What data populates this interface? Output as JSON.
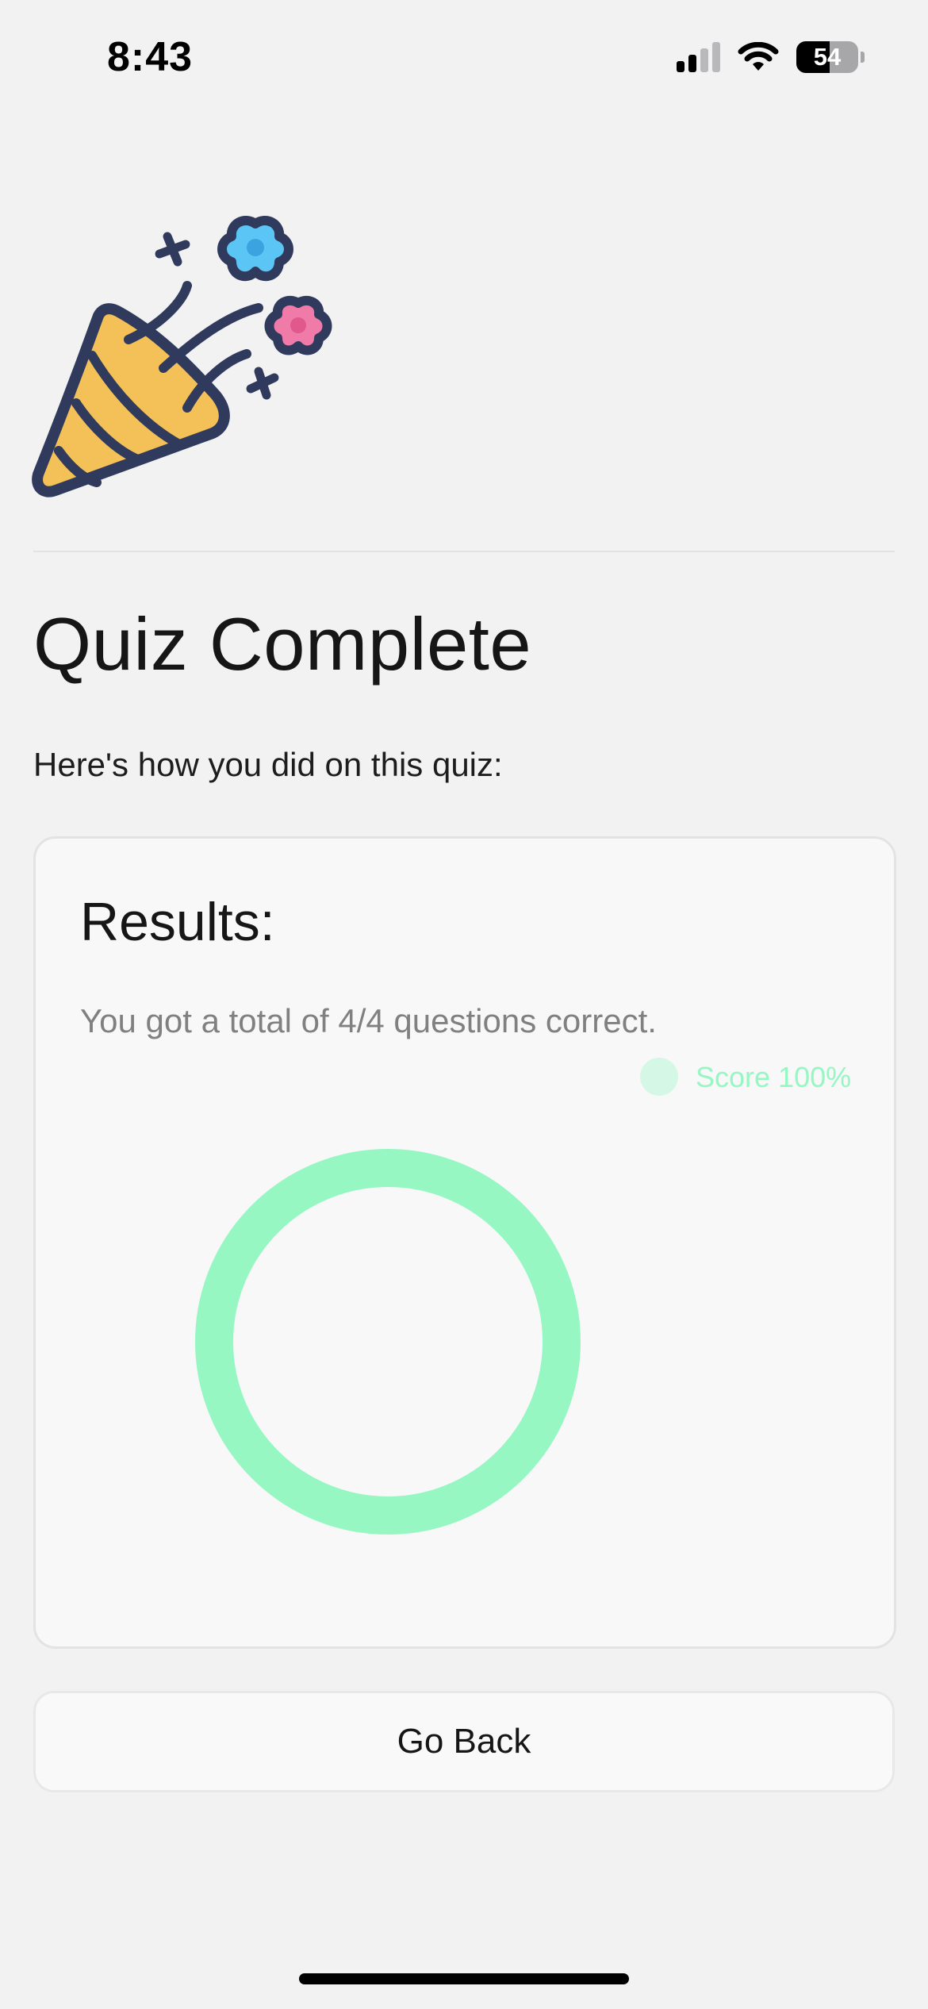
{
  "status_bar": {
    "time": "8:43",
    "battery": "54",
    "battery_level": 0.54,
    "signal_bars_active": 2,
    "signal_bars_total": 4,
    "icons": [
      "signal-icon",
      "wifi-icon",
      "battery-icon"
    ]
  },
  "hero": {
    "icon": "party-popper-icon"
  },
  "page": {
    "title": "Quiz Complete",
    "subtitle": "Here's how you did on this quiz:"
  },
  "results": {
    "heading": "Results:",
    "summary": "You got a total of 4/4 questions correct."
  },
  "chart_data": {
    "type": "pie",
    "subtype": "doughnut",
    "series": [
      {
        "name": "Score 100%",
        "value": 100,
        "color": "#96f7c3"
      }
    ],
    "legend_placement": "top-right"
  },
  "actions": {
    "go_back_label": "Go Back"
  },
  "colors": {
    "background": "#f2f2f3",
    "card": "#f8f8f9",
    "accent_green": "#96f7c3",
    "muted_text": "#808080"
  }
}
